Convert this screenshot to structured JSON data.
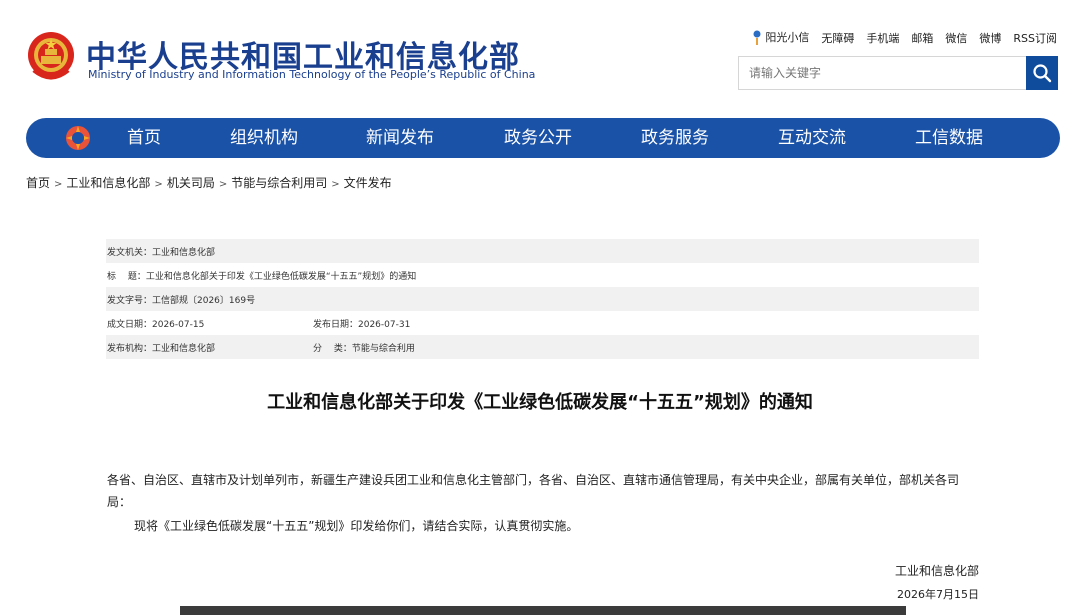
{
  "header": {
    "title_cn": "中华人民共和国工业和信息化部",
    "title_en": "Ministry of Industry and Information Technology of the People’s Republic of China",
    "emblem_icon": "national-emblem-icon",
    "toplinks": [
      "阳光小信",
      "无障碍",
      "手机端",
      "邮箱",
      "微信",
      "微博",
      "RSS订阅"
    ],
    "search": {
      "placeholder": "请输入关键字",
      "icon": "search-icon"
    }
  },
  "nav": {
    "logo_icon": "miit-logo-icon",
    "items": [
      "首页",
      "组织机构",
      "新闻发布",
      "政务公开",
      "政务服务",
      "互动交流",
      "工信数据"
    ],
    "color": "#1a52a8"
  },
  "breadcrumb": [
    "首页",
    "工业和信息化部",
    "机关司局",
    "节能与综合利用司",
    "文件发布"
  ],
  "meta": {
    "issuer": "发文机关：工业和信息化部",
    "title": "标　  题：工业和信息化部关于印发《工业绿色低碳发展“十五五”规划》的通知",
    "doc_no": "发文字号：工信部规〔2026〕169号",
    "written_date": "成文日期：2026-07-15",
    "publish_date": "发布日期：2026-07-31",
    "publisher": "发布机构：工业和信息化部",
    "category": "分　  类：节能与综合利用"
  },
  "article": {
    "title": "工业和信息化部关于印发《工业绿色低碳发展“十五五”规划》的通知",
    "salutation": "各省、自治区、直辖市及计划单列市，新疆生产建设兵团工业和信息化主管部门，各省、自治区、直辖市通信管理局，有关中央企业，部属有关单位，部机关各司局：",
    "body": "现将《工业绿色低碳发展“十五五”规划》印发给你们，请结合实际，认真贯彻实施。",
    "signature_org": "工业和信息化部",
    "signature_date": "2026年7月15日"
  }
}
